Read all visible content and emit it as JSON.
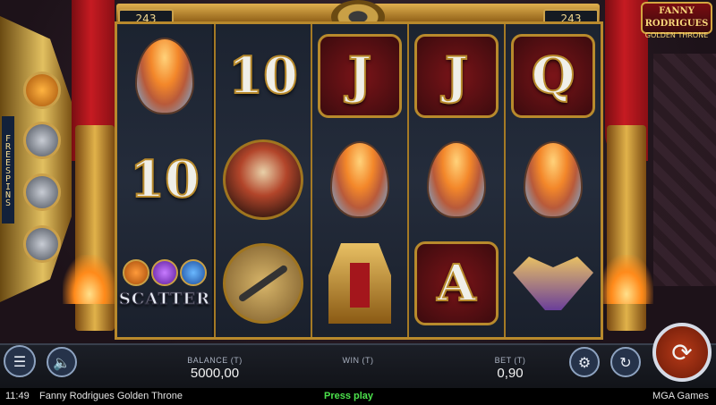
{
  "game": {
    "title": "Fanny Rodrigues Golden Throne",
    "logo_line1": "FANNY RODRIGUES",
    "logo_line2": "GOLDEN THRONE"
  },
  "ways": {
    "left": "243",
    "right": "243"
  },
  "freespins_label": "FREESPINS",
  "reels": [
    [
      {
        "symbol": "egg"
      },
      {
        "symbol": "royal",
        "label": "10"
      },
      {
        "symbol": "scatter",
        "label": "SCATTER"
      }
    ],
    [
      {
        "symbol": "royal",
        "label": "10"
      },
      {
        "symbol": "ship"
      },
      {
        "symbol": "sword"
      }
    ],
    [
      {
        "symbol": "royal",
        "label": "J"
      },
      {
        "symbol": "egg"
      },
      {
        "symbol": "throne"
      }
    ],
    [
      {
        "symbol": "royal",
        "label": "J"
      },
      {
        "symbol": "egg"
      },
      {
        "symbol": "royal",
        "label": "A"
      }
    ],
    [
      {
        "symbol": "royal",
        "label": "Q"
      },
      {
        "symbol": "egg"
      },
      {
        "symbol": "crown"
      }
    ]
  ],
  "hud": {
    "balance_label": "BALANCE (T)",
    "balance_value": "5000,00",
    "win_label": "WIN (T)",
    "win_value": "",
    "bet_label": "BET (T)",
    "bet_value": "0,90"
  },
  "status": {
    "time": "11:49",
    "game_name": "Fanny Rodrigues Golden Throne",
    "message": "Press play",
    "provider": "MGA Games"
  },
  "colors": {
    "gold": "#caa04a",
    "press_play": "#4ce24c",
    "spin": "#b73a18"
  }
}
